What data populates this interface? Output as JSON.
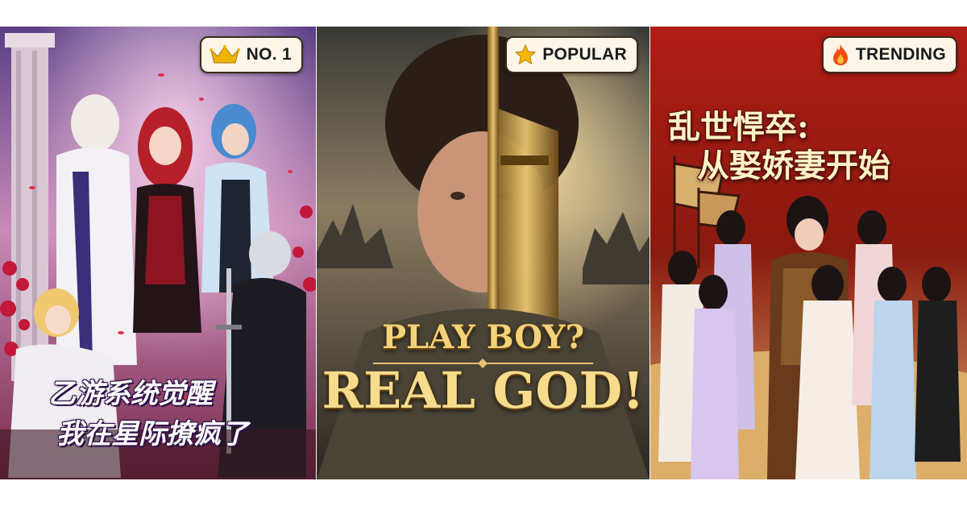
{
  "posters": [
    {
      "badge": {
        "label": "NO. 1",
        "icon": "crown-icon"
      },
      "title_lines": [
        "乙游系统觉醒",
        "我在星际撩疯了"
      ]
    },
    {
      "badge": {
        "label": "POPULAR",
        "icon": "star-icon"
      },
      "title_lines": [
        "PLAY BOY?",
        "REAL GOD!"
      ]
    },
    {
      "badge": {
        "label": "TRENDING",
        "icon": "fire-icon"
      },
      "title_lines": [
        "乱世悍卒:",
        "从娶娇妻开始"
      ]
    }
  ],
  "colors": {
    "badge_bg": "#fff6e8",
    "badge_border": "#3a2a1a",
    "crown": "#f2b400",
    "star": "#f5b800",
    "fire": "#f24a12"
  }
}
